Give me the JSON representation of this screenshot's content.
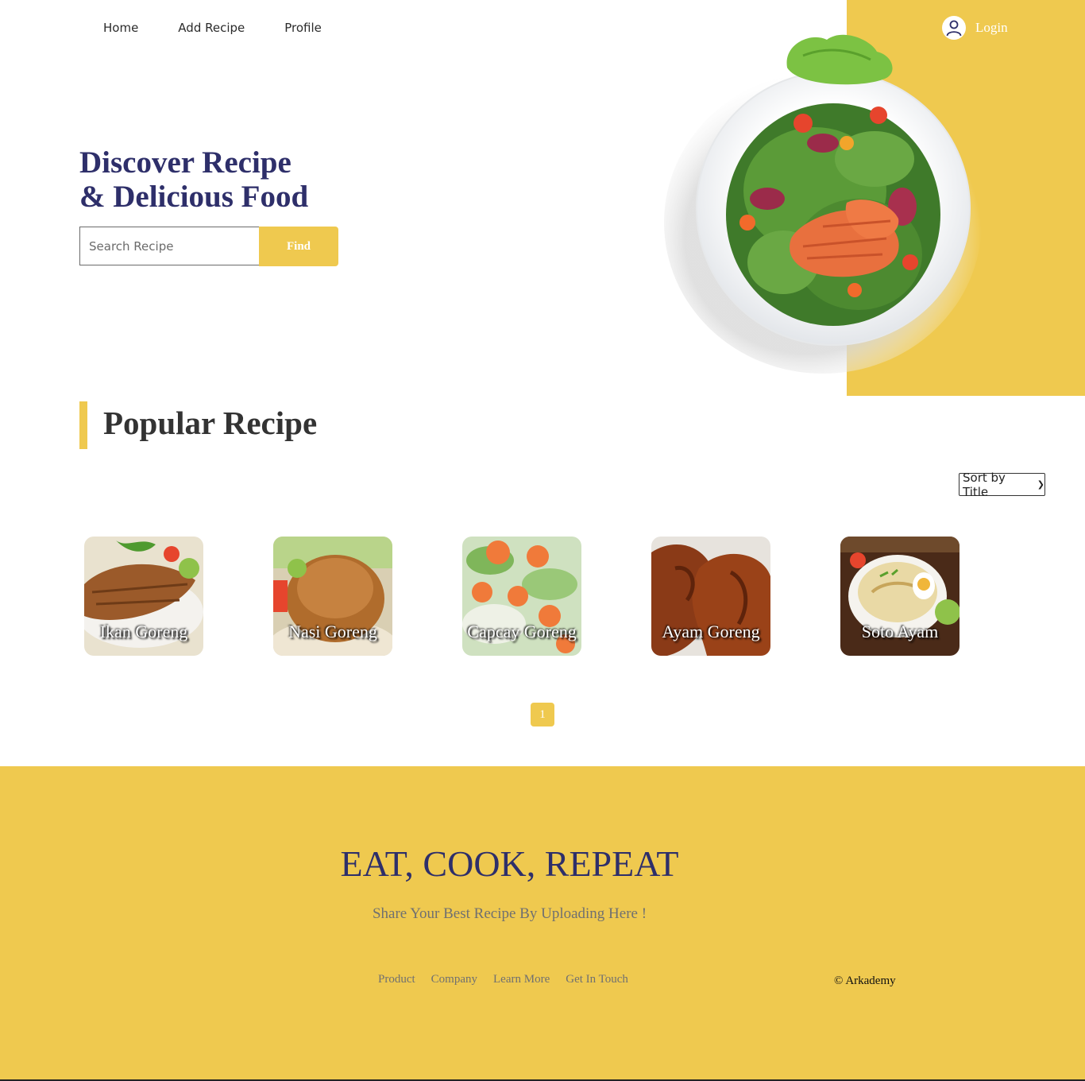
{
  "nav": {
    "items": [
      "Home",
      "Add Recipe",
      "Profile"
    ]
  },
  "login": {
    "label": "Login",
    "icon": "user-icon"
  },
  "hero": {
    "headline_line1": "Discover Recipe",
    "headline_line2": "& Delicious Food",
    "search_placeholder": "Search Recipe",
    "search_value": "",
    "find_label": "Find"
  },
  "popular": {
    "title": "Popular Recipe",
    "sort_selected": "Sort by Title",
    "recipes": [
      {
        "title": "Ikan Goreng"
      },
      {
        "title": "Nasi Goreng"
      },
      {
        "title": "Capcay Goreng"
      },
      {
        "title": "Ayam Goreng"
      },
      {
        "title": "Soto Ayam"
      }
    ],
    "pagination": {
      "current": "1"
    }
  },
  "footer": {
    "title": "EAT, COOK, REPEAT",
    "subtitle": "Share Your Best Recipe By Uploading Here !",
    "links": [
      "Product",
      "Company",
      "Learn More",
      "Get In Touch"
    ],
    "copyright": "© Arkademy"
  },
  "colors": {
    "accent": "#efc94f",
    "headline": "#2e2f6a",
    "muted_text": "#707070"
  }
}
